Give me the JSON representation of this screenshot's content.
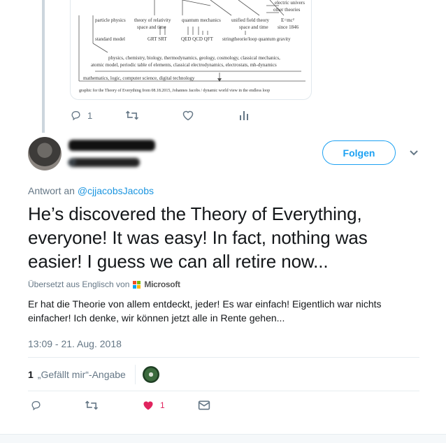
{
  "diagram": {
    "top_labels": [
      "electric univers",
      "other theories"
    ],
    "row1": [
      "particle physics",
      "theory of relativity",
      "quantum mechanics",
      "unified field theory",
      "E=mc²"
    ],
    "row1b": [
      "space and time",
      "space and time",
      "since 1846"
    ],
    "row2": [
      "standard model",
      "GRT SRT",
      "QED QCD QFT",
      "stringtheorie/loop quantum gravity"
    ],
    "row3": [
      "physics, chemistry, biology, thermodynamics, geology, cosmology, classical mechanics,",
      "atomic model, periodic table of elements, classical electrodynamics, electrostats, mh-dynamics"
    ],
    "row4": "mathematics, logic, computer science, digital technology",
    "caption": "graphic for the Theory of Everything from 08.18.2015, Johannes Jacobs / dynamic world view in the endless loop"
  },
  "prev_tweet_actions": {
    "reply_count": "1"
  },
  "author": {
    "follow_label": "Folgen"
  },
  "tweet": {
    "reply_prefix": "Antwort an ",
    "reply_handle": "@cjjacobsJacobs",
    "text": "He’s discovered the Theory of Everything, everyone! It was easy! In fact, nothing was easier! I guess we can all retire now...",
    "translated_by": "Übersetzt aus Englisch von",
    "translator": "Microsoft",
    "translation": "Er hat die Theorie von allem entdeckt, jeder! Es war einfach! Eigentlich war nichts einfacher! Ich denke, wir können jetzt alle in Rente gehen...",
    "timestamp": "13:09 - 21. Aug. 2018",
    "like_count": "1",
    "like_label": "„Gefällt mir“-Angabe"
  },
  "actions": {
    "like_count": "1"
  },
  "colors": {
    "accent": "#1da1f2",
    "like": "#e0245e",
    "muted": "#657786",
    "ms_red": "#f25022",
    "ms_green": "#7fba00",
    "ms_blue": "#00a4ef",
    "ms_yellow": "#ffb900"
  },
  "icons": [
    "reply-icon",
    "retweet-icon",
    "heart-icon",
    "analytics-icon",
    "chevron-down-icon",
    "message-icon",
    "microsoft-logo-icon"
  ]
}
